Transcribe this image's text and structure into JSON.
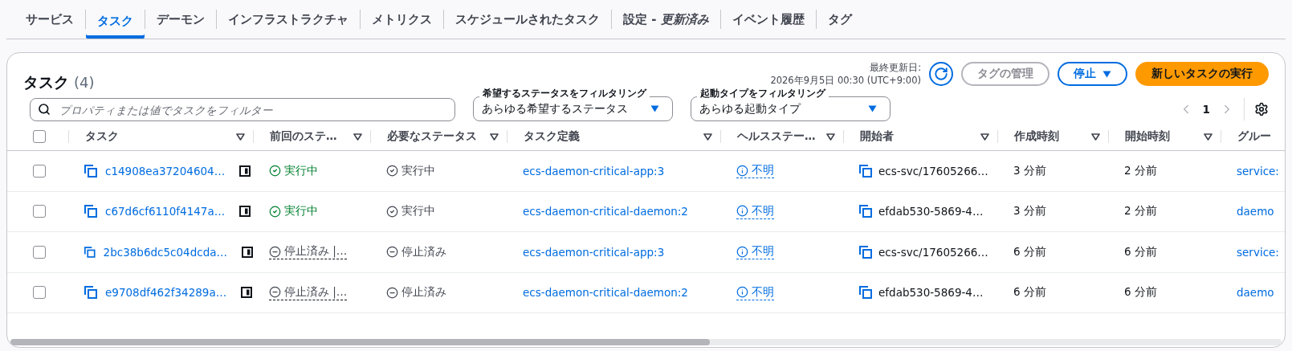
{
  "tabs": [
    {
      "label": "サービス",
      "selected": false
    },
    {
      "label": "タスク",
      "selected": true
    },
    {
      "label": "デーモン",
      "selected": false
    },
    {
      "label": "インフラストラクチャ",
      "selected": false
    },
    {
      "label": "メトリクス",
      "selected": false
    },
    {
      "label": "スケジュールされたタスク",
      "selected": false
    },
    {
      "label": "設定 - *更新済み*",
      "selected": false
    },
    {
      "label": "イベント履歴",
      "selected": false
    },
    {
      "label": "タグ",
      "selected": false
    }
  ],
  "panel": {
    "title": "タスク",
    "count": "(4)",
    "last_updated_label": "最終更新日:",
    "last_updated": "2026年9月5日 00:30 (UTC+9:00)",
    "buttons": [
      {
        "kind": "refresh"
      },
      {
        "kind": "outline",
        "label": "タグの管理",
        "disabled": true
      },
      {
        "kind": "dropdown",
        "label": "停止",
        "disabled": false
      },
      {
        "kind": "primary",
        "label": "新しいタスクの実行"
      }
    ],
    "search": {
      "placeholder": "プロパティまたは値でタスクをフィルター"
    },
    "filters": [
      {
        "label": "希望するステータスをフィルタリング",
        "value": "あらゆる希望するステータス"
      },
      {
        "label": "起動タイプをフィルタリング",
        "value": "あらゆる起動タイプ"
      }
    ],
    "pagination": {
      "page": "1",
      "prev_disabled": true,
      "next_disabled": true
    }
  },
  "table": {
    "select_all_checked": false,
    "columns": [
      {
        "label": "タスク",
        "sortable": true
      },
      {
        "label": "前回のステ…",
        "sortable": true
      },
      {
        "label": "必要なステータス",
        "sortable": true
      },
      {
        "label": "タスク定義",
        "sortable": true
      },
      {
        "label": "ヘルスステー…",
        "sortable": true
      },
      {
        "label": "開始者",
        "sortable": true
      },
      {
        "label": "作成時刻",
        "sortable": true
      },
      {
        "label": "開始時刻",
        "sortable": true
      },
      {
        "label": "グルー",
        "sortable": false
      }
    ],
    "rows": [
      {
        "selected": false,
        "task": "c14908ea37204604…",
        "last_status": {
          "kind": "running",
          "text": "実行中"
        },
        "desired_status": {
          "kind": "running",
          "text": "実行中"
        },
        "task_definition": "ecs-daemon-critical-app:3",
        "health": "不明",
        "started_by": "ecs-svc/17605266…",
        "created": "3 分前",
        "started": "2 分前",
        "group": "service:"
      },
      {
        "selected": false,
        "task": "c67d6cf6110f4147a…",
        "last_status": {
          "kind": "running",
          "text": "実行中"
        },
        "desired_status": {
          "kind": "running",
          "text": "実行中"
        },
        "task_definition": "ecs-daemon-critical-daemon:2",
        "health": "不明",
        "started_by": "efdab530-5869-4…",
        "created": "3 分前",
        "started": "2 分前",
        "group": "daemo"
      },
      {
        "selected": false,
        "task": "2bc38b6dc5c04dcda…",
        "last_status": {
          "kind": "stopped",
          "text": "停止済み |…"
        },
        "desired_status": {
          "kind": "stopped",
          "text": "停止済み"
        },
        "task_definition": "ecs-daemon-critical-app:3",
        "health": "不明",
        "started_by": "ecs-svc/17605266…",
        "created": "6 分前",
        "started": "6 分前",
        "group": "service:"
      },
      {
        "selected": false,
        "task": "e9708df462f34289a…",
        "last_status": {
          "kind": "stopped",
          "text": "停止済み |…"
        },
        "desired_status": {
          "kind": "stopped",
          "text": "停止済み"
        },
        "task_definition": "ecs-daemon-critical-daemon:2",
        "health": "不明",
        "started_by": "efdab530-5869-4…",
        "created": "6 分前",
        "started": "6 分前",
        "group": "daemo"
      }
    ]
  }
}
